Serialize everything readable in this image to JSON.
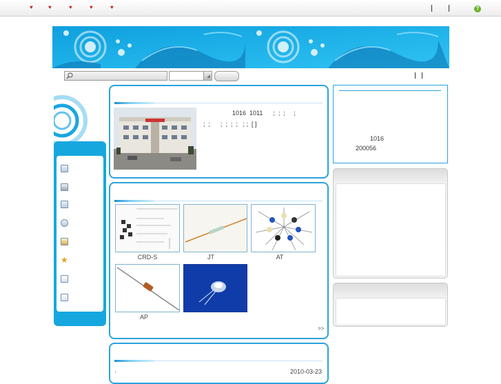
{
  "topbar": {
    "nav_count": 5,
    "help_icon": "help-icon",
    "help_glyph": "?"
  },
  "search": {
    "placeholder": "",
    "icon": "search-icon"
  },
  "intro": {
    "line1": "1016  1011      ;  ;  ;     ;",
    "line2": ";  ;      ;  ;  ;  ;   ; ;  [ ]"
  },
  "products": {
    "items": [
      {
        "label": "CRD-S"
      },
      {
        "label": "JT"
      },
      {
        "label": "AT"
      },
      {
        "label": "AP"
      },
      {
        "label": ""
      }
    ],
    "more_label": ">>"
  },
  "news": {
    "item_bullet": "·",
    "item_date": "2010-03-23"
  },
  "contact": {
    "address_no": "1016",
    "postcode": "200056"
  },
  "colors": {
    "accent": "#2aa3dc",
    "banner": "#12b2ea",
    "nav_heart": "#cc2222"
  }
}
